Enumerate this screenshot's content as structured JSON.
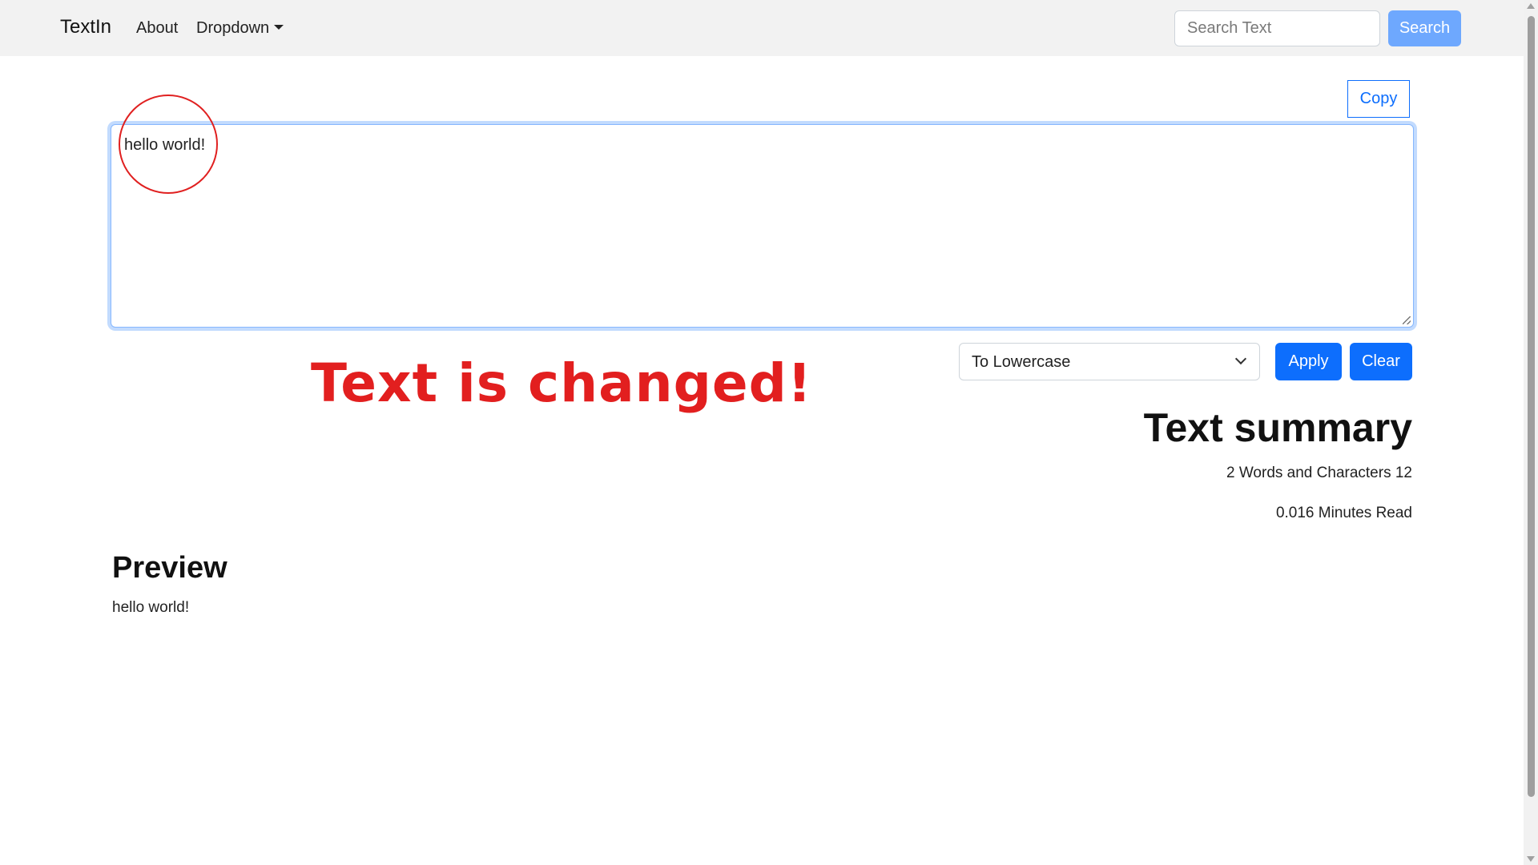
{
  "navbar": {
    "brand": "TextIn",
    "about_label": "About",
    "dropdown_label": "Dropdown",
    "search_placeholder": "Search Text",
    "search_button": "Search"
  },
  "editor": {
    "copy_label": "Copy",
    "text": "hello world!"
  },
  "controls": {
    "operation_selected": "To Lowercase",
    "apply_label": "Apply",
    "clear_label": "Clear"
  },
  "annotation": {
    "note": "Text is changed!"
  },
  "summary": {
    "title": "Text summary",
    "word_count": "2",
    "words_label": "Words and Characters",
    "char_count": "12",
    "minutes": "0.016",
    "minutes_label": "Minutes Read"
  },
  "preview": {
    "title": "Preview",
    "text": "hello world!"
  },
  "colors": {
    "primary": "#0d6efd",
    "primary_light": "#6ea8fe",
    "annotation_red": "#e21f1f",
    "navbar_bg": "#f2f2f2"
  }
}
